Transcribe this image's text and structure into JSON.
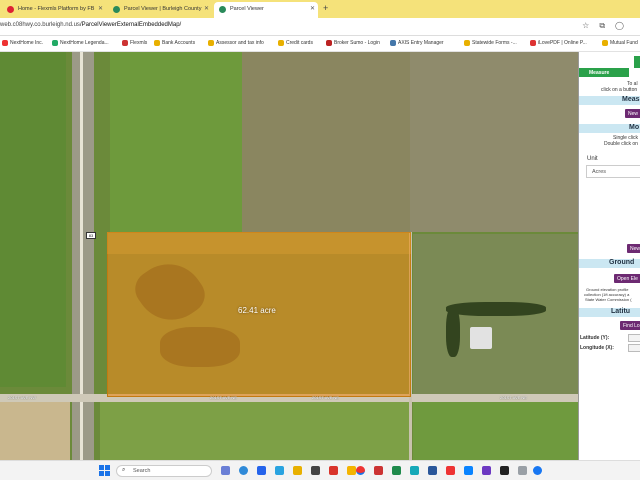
{
  "browser": {
    "tabs": [
      {
        "label": "Home - Flexmls Platform by FB"
      },
      {
        "label": "Parcel Viewer | Burleigh County"
      },
      {
        "label": "Parcel Viewer"
      }
    ],
    "new_tab": "+",
    "url_host": "web.co.burleigh.nd.us",
    "url_prefix": "web.c08hwy.co.burleigh.nd.us",
    "url_path": "/ParcelViewerExternalEmbeddedMap/",
    "bookmarks": [
      "NextHome Inc.",
      "NextHome Legenda...",
      "Flexmls",
      "Bank Accounts",
      "Assessor and tax info",
      "Credit cards",
      "Broker Sumo - Login",
      "AXIS Entry Manager",
      "Statewide Forms -...",
      "iLovePDF | Online P...",
      "Mutual Fund"
    ]
  },
  "map": {
    "parcel_label": "62.41 acre",
    "route_badge": "83",
    "road_labels": [
      "201ST AVE NW",
      "201ST AVE NE",
      "201ST AVE NE",
      "201ST AVE NE"
    ]
  },
  "panel": {
    "measure_tab": "Measure",
    "intro_line1": "To al",
    "intro_line2": "click on a button",
    "measure_header": "Meas",
    "new_button": "New",
    "mode_header": "Mo",
    "single_click": "Single click",
    "double_click": "Double click on",
    "unit_label": "Unit",
    "unit_value": "Acres",
    "new_button2": "New",
    "ground_header": "Ground",
    "open_button": "Open Ele",
    "ground_text1": "Ground elevation profile",
    "ground_text2": "collection (1ft accuracy) a",
    "ground_text3": "State Water Commission (",
    "latlon_header": "Latitu",
    "find_button": "Find Lo",
    "latitude_label": "Latitude (Y):",
    "longitude_label": "Longitude (X):"
  },
  "taskbar": {
    "search_placeholder": "Search"
  }
}
